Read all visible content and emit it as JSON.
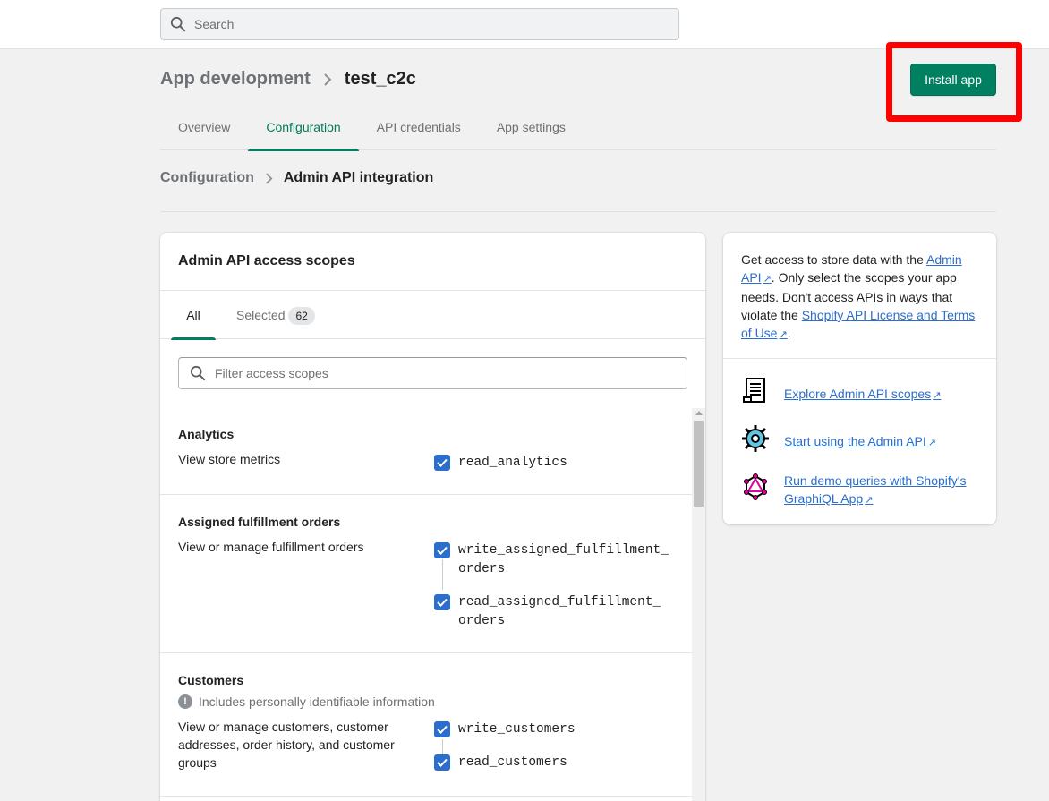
{
  "topbar": {
    "search_placeholder": "Search"
  },
  "header": {
    "breadcrumb_parent": "App development",
    "title": "test_c2c",
    "install_label": "Install app"
  },
  "tabs": [
    {
      "label": "Overview"
    },
    {
      "label": "Configuration"
    },
    {
      "label": "API credentials"
    },
    {
      "label": "App settings"
    }
  ],
  "subheader": {
    "parent": "Configuration",
    "current": "Admin API integration"
  },
  "scopes_card": {
    "title": "Admin API access scopes",
    "tab_all": "All",
    "tab_selected": "Selected",
    "selected_count": "62",
    "filter_placeholder": "Filter access scopes",
    "sections": [
      {
        "title": "Analytics",
        "description": "View store metrics",
        "scopes": [
          "read_analytics"
        ]
      },
      {
        "title": "Assigned fulfillment orders",
        "description": "View or manage fulfillment orders",
        "scopes": [
          "write_assigned_fulfillment_orders",
          "read_assigned_fulfillment_orders"
        ],
        "scopes_display": [
          "write_assigned_fulfillment_\norders",
          "read_assigned_fulfillment_\norders"
        ]
      },
      {
        "title": "Customers",
        "pii_note": "Includes personally identifiable information",
        "description": "View or manage customers, customer addresses, order history, and customer groups",
        "scopes": [
          "write_customers",
          "read_customers"
        ]
      }
    ]
  },
  "side_card": {
    "text_1": "Get access to store data with the ",
    "link_admin_api": "Admin API",
    "text_2": ". Only select the scopes your app needs. Don't access APIs in ways that violate the ",
    "link_license": "Shopify API License and Terms of Use",
    "text_3": ".",
    "resources": [
      {
        "label": "Explore Admin API scopes",
        "icon": "document-scroll-icon"
      },
      {
        "label": "Start using the Admin API",
        "icon": "gear-icon"
      },
      {
        "label": "Run demo queries with Shopify's GraphiQL App",
        "icon": "graphql-icon"
      }
    ]
  },
  "colors": {
    "primary": "#008060",
    "link": "#2c6ecb",
    "checkbox": "#2c6ecb",
    "highlight": "#ff0000"
  }
}
